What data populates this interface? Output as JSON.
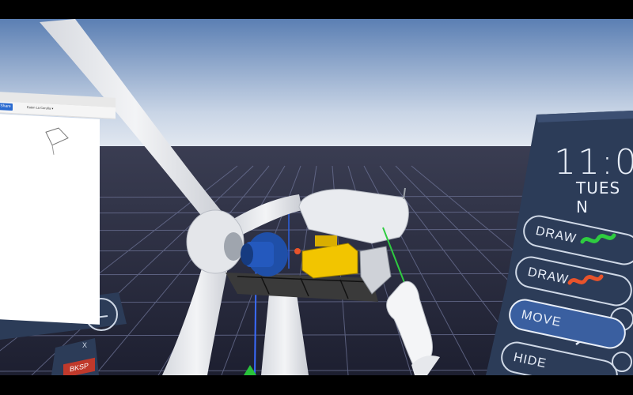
{
  "scene": {
    "colors": {
      "sky_top": "#5b7fb3",
      "sky_horizon": "#dfe7f1",
      "floor": "#23253a",
      "grid": "#6d7396",
      "turbine": "#e8eaee",
      "generator": "#f2c500",
      "gearbox": "#1f4fa8",
      "panel": "#2c3c58",
      "accent_green": "#2ecc40",
      "accent_orange": "#e8532b"
    }
  },
  "browser_panel": {
    "share_label": "Share",
    "doc_title": "Eaton La Coruña ▾"
  },
  "wrist_panel": {
    "time": "11:0",
    "day": "TUES N",
    "buttons": [
      {
        "label": "DRAW",
        "icon": "green-squiggle-icon"
      },
      {
        "label": "DRAW",
        "icon": "orange-squiggle-icon"
      },
      {
        "label": "MOVE",
        "icon": "move-arrows-icon"
      },
      {
        "label": "HIDE",
        "icon": "hide-icon"
      }
    ]
  },
  "keyboard": {
    "backspace_label": "BKSP",
    "close_label": "X"
  }
}
